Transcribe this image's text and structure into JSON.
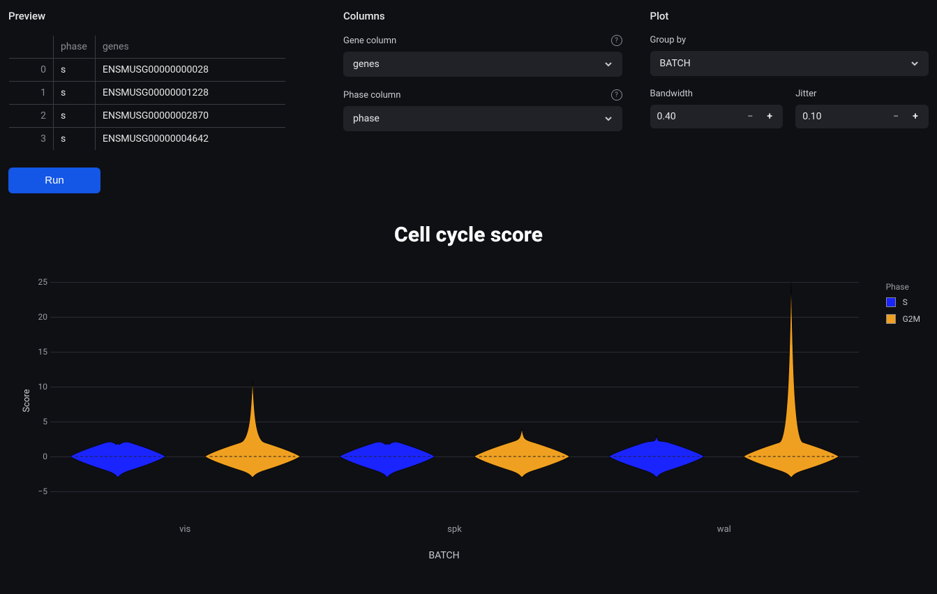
{
  "preview": {
    "title": "Preview",
    "columns": [
      "",
      "phase",
      "genes"
    ],
    "rows": [
      {
        "idx": "0",
        "phase": "s",
        "genes": "ENSMUSG00000000028"
      },
      {
        "idx": "1",
        "phase": "s",
        "genes": "ENSMUSG00000001228"
      },
      {
        "idx": "2",
        "phase": "s",
        "genes": "ENSMUSG00000002870"
      },
      {
        "idx": "3",
        "phase": "s",
        "genes": "ENSMUSG00000004642"
      }
    ],
    "run_label": "Run"
  },
  "columns_panel": {
    "title": "Columns",
    "gene_label": "Gene column",
    "gene_value": "genes",
    "phase_label": "Phase column",
    "phase_value": "phase"
  },
  "plot_panel": {
    "title": "Plot",
    "groupby_label": "Group by",
    "groupby_value": "BATCH",
    "bandwidth_label": "Bandwidth",
    "bandwidth_value": "0.40",
    "jitter_label": "Jitter",
    "jitter_value": "0.10"
  },
  "chart_data": {
    "type": "violin",
    "title": "Cell cycle score",
    "xlabel": "BATCH",
    "ylabel": "Score",
    "ylim": [
      -5,
      25
    ],
    "yticks": [
      -5,
      0,
      5,
      10,
      15,
      20,
      25
    ],
    "categories": [
      "vis",
      "spk",
      "wal"
    ],
    "legend_title": "Phase",
    "series": [
      {
        "name": "S",
        "color": "#1a24ff",
        "median": 0,
        "spread": 2,
        "tail_max": [
          2,
          2,
          3
        ]
      },
      {
        "name": "G2M",
        "color": "#f0a020",
        "median": 0,
        "spread": 2,
        "tail_max": [
          11,
          4,
          25
        ]
      }
    ]
  }
}
